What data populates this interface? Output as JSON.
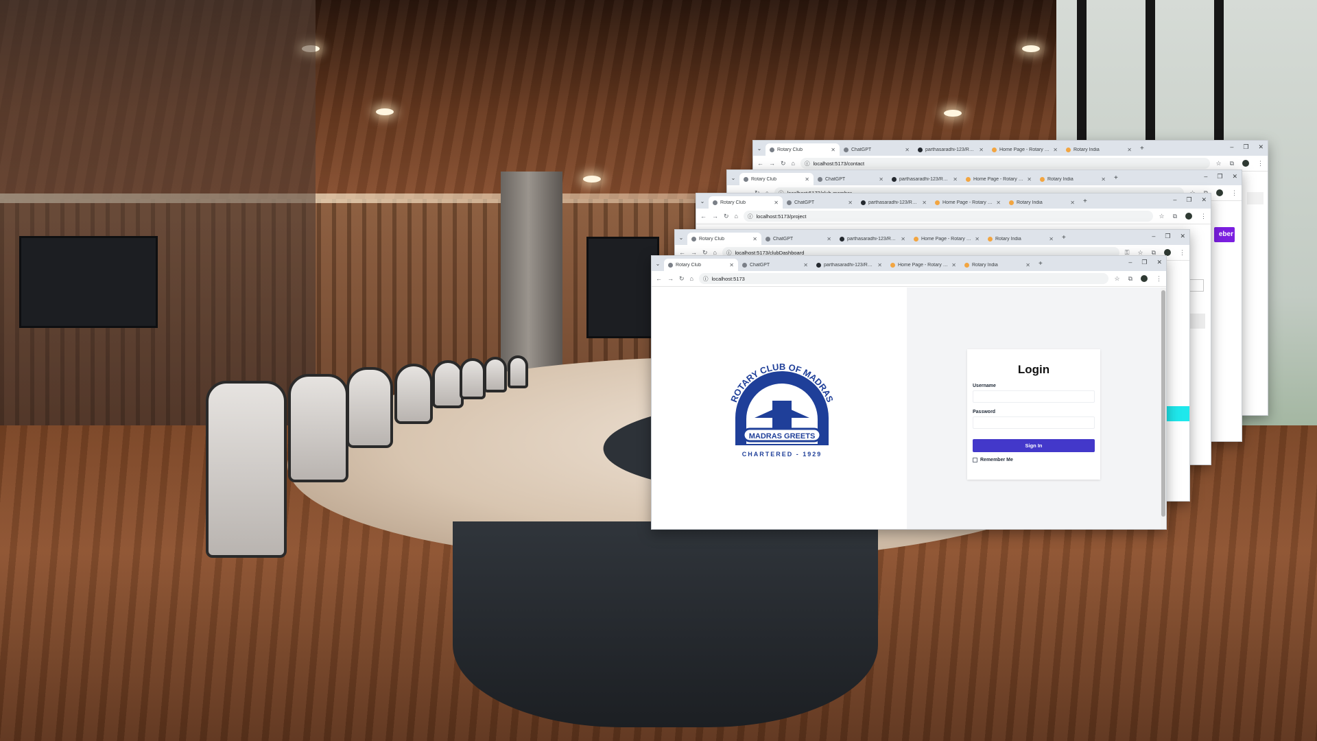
{
  "colors": {
    "accent": "#4338ca",
    "logo_blue": "#1f3f99",
    "card_bg": "#ffffff",
    "page_bg": "#f3f4f6",
    "purple_button": "#7b1fe0",
    "cyan_block": "#1fe8ec"
  },
  "icons": {
    "tab_menu": "chevron-down-icon",
    "close": "close-icon",
    "new_tab": "plus-icon",
    "back": "arrow-left-icon",
    "forward": "arrow-right-icon",
    "reload": "reload-icon",
    "home": "home-icon",
    "site_info": "info-icon",
    "bookmark": "star-icon",
    "extensions": "puzzle-icon",
    "menu": "kebab-icon"
  },
  "windows": [
    {
      "url": "localhost:5173/contact",
      "tabs": [
        "Rotary Club",
        "ChatGPT",
        "parthasaradhi-123/Rotary-Clu...",
        "Home Page - Rotary Club of M...",
        "Rotary India"
      ]
    },
    {
      "url": "localhost:5173/club-member",
      "tabs": [
        "Rotary Club",
        "ChatGPT",
        "parthasaradhi-123/Rotary-Clu...",
        "Home Page - Rotary Club of M...",
        "Rotary India"
      ]
    },
    {
      "url": "localhost:5173/project",
      "tabs": [
        "Rotary Club",
        "ChatGPT",
        "parthasaradhi-123/Rotary-Clu...",
        "Home Page - Rotary Club of M...",
        "Rotary India"
      ]
    },
    {
      "url": "localhost:5173/clubDashboard",
      "tabs": [
        "Rotary Club",
        "ChatGPT",
        "parthasaradhi-123/Rotary-Clu...",
        "Home Page - Rotary Club of M...",
        "Rotary India"
      ]
    },
    {
      "url": "localhost:5173",
      "tabs": [
        "Rotary Club",
        "ChatGPT",
        "parthasaradhi-123/Rotary-Clu...",
        "Home Page - Rotary Club of M...",
        "Rotary India"
      ]
    }
  ],
  "behind_fragments": {
    "purple_button_text": "eber"
  },
  "logo": {
    "arc_text": "ROTARY CLUB OF MADRAS",
    "banner_text": "MADRAS GREETS",
    "bottom_text": "CHARTERED - 1929"
  },
  "login": {
    "title": "Login",
    "username_label": "Username",
    "username_value": "",
    "password_label": "Password",
    "password_value": "",
    "signin_label": "Sign In",
    "remember_label": "Remember Me"
  }
}
